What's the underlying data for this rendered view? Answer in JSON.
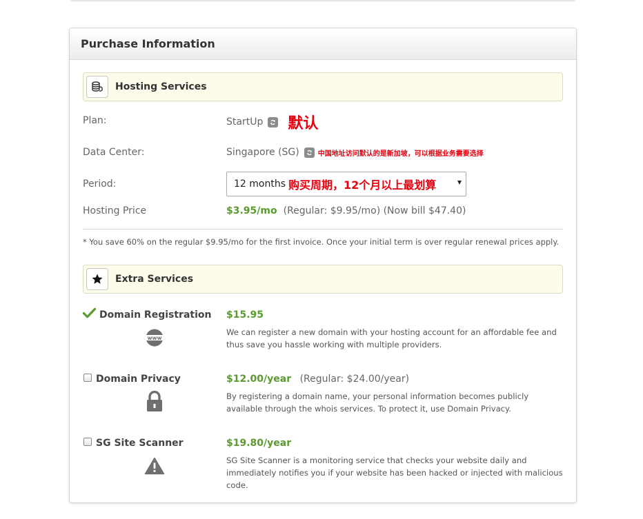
{
  "purchase": {
    "title": "Purchase Information",
    "hosting": {
      "section_label": "Hosting Services",
      "section_icon": "coins-stack-icon",
      "plan_label": "Plan:",
      "plan_value": "StartUp",
      "plan_note": "默认",
      "dc_label": "Data Center:",
      "dc_value": "Singapore (SG)",
      "dc_note": "中国地址访问默认的是新加坡，可以根据业务需要选择",
      "period_label": "Period:",
      "period_value": "12 months",
      "period_note": "购买周期，12个月以上最划算",
      "price_label": "Hosting Price",
      "price_value": "$3.95/mo",
      "price_regular": "(Regular: $9.95/mo) (Now bill $47.40)"
    },
    "savings_note": "* You save 60% on the regular $9.95/mo for the first invoice. Once your initial term is over regular renewal prices apply.",
    "extras": {
      "section_label": "Extra Services",
      "section_icon": "star-icon",
      "items": [
        {
          "name": "Domain Registration",
          "checked": true,
          "icon": "www-globe-icon",
          "price": "$15.95",
          "regular": "",
          "desc": "We can register a new domain with your hosting account for an affordable fee and thus save you hassle working with multiple providers."
        },
        {
          "name": "Domain Privacy",
          "checked": false,
          "icon": "lock-icon",
          "price": "$12.00/year",
          "regular": "(Regular: $24.00/year)",
          "desc": "By registering a domain name, your personal information becomes publicly available through the whois services. To protect it, use Domain Privacy."
        },
        {
          "name": "SG Site Scanner",
          "checked": false,
          "icon": "warning-triangle-icon",
          "price": "$19.80/year",
          "regular": "",
          "desc": "SG Site Scanner is a monitoring service that checks your website daily and immediately notifies you if your website has been hacked or injected with malicious code."
        }
      ]
    },
    "colors": {
      "price_green": "#5b9a2e",
      "annotation_red": "#e8000e",
      "section_bg": "#fdfbe9"
    }
  }
}
